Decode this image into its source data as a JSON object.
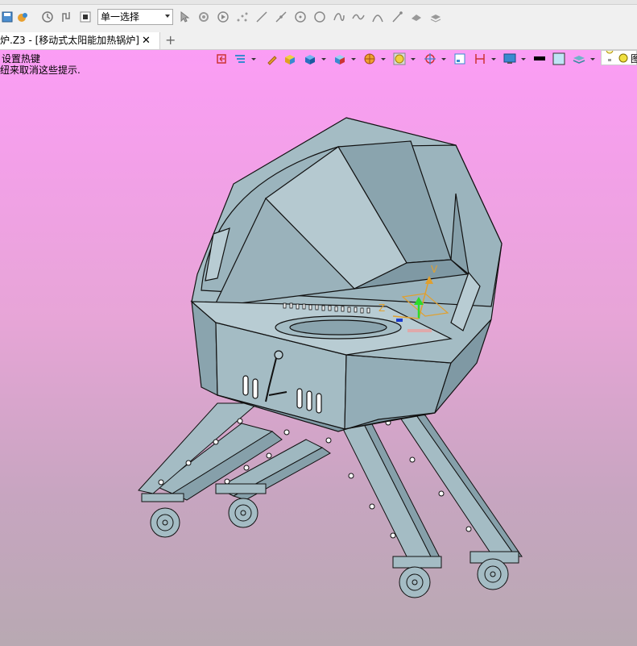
{
  "toolbar": {
    "select_mode_value": "单一选择",
    "icons": [
      "save-icon",
      "render-icon",
      "history-icon",
      "history-alt-icon",
      "stop-icon",
      "cursor-icon",
      "filter-icon",
      "play-icon",
      "points-icon",
      "line-icon",
      "segment-icon",
      "circle-center-icon",
      "circle-icon",
      "curve-icon",
      "spline-icon",
      "arc-icon",
      "snap-icon",
      "fillet-icon",
      "layer-icon"
    ]
  },
  "tab": {
    "title": "炉.Z3 - [移动式太阳能加热锅炉]",
    "close_label": "✕",
    "add_label": "+"
  },
  "hints": {
    "line1": "设置热键",
    "line2": "纽来取消这些提示."
  },
  "view_toolbar": {
    "icons": [
      "view-back-icon",
      "filter-display-icon",
      "pencil-icon",
      "box-shade-icon",
      "cube-icon",
      "cube-view-icon",
      "sphere-render-icon",
      "clock-frame-icon",
      "target-icon",
      "window-icon",
      "dimension-icon",
      "monitor-icon",
      "black-color-icon",
      "fill-color-icon",
      "layer-stack-icon",
      "bulb-icon",
      "sun-icon"
    ],
    "palette_text": "图"
  },
  "triad": {
    "x_label": "Z",
    "y_label": "V"
  },
  "colors": {
    "model_fill": "#a4bcc4",
    "model_dark": "#7f99a4",
    "model_light": "#b8ccd3",
    "edge": "#111111",
    "triad_orange": "#e0a030",
    "triad_green": "#2bdc2b"
  }
}
